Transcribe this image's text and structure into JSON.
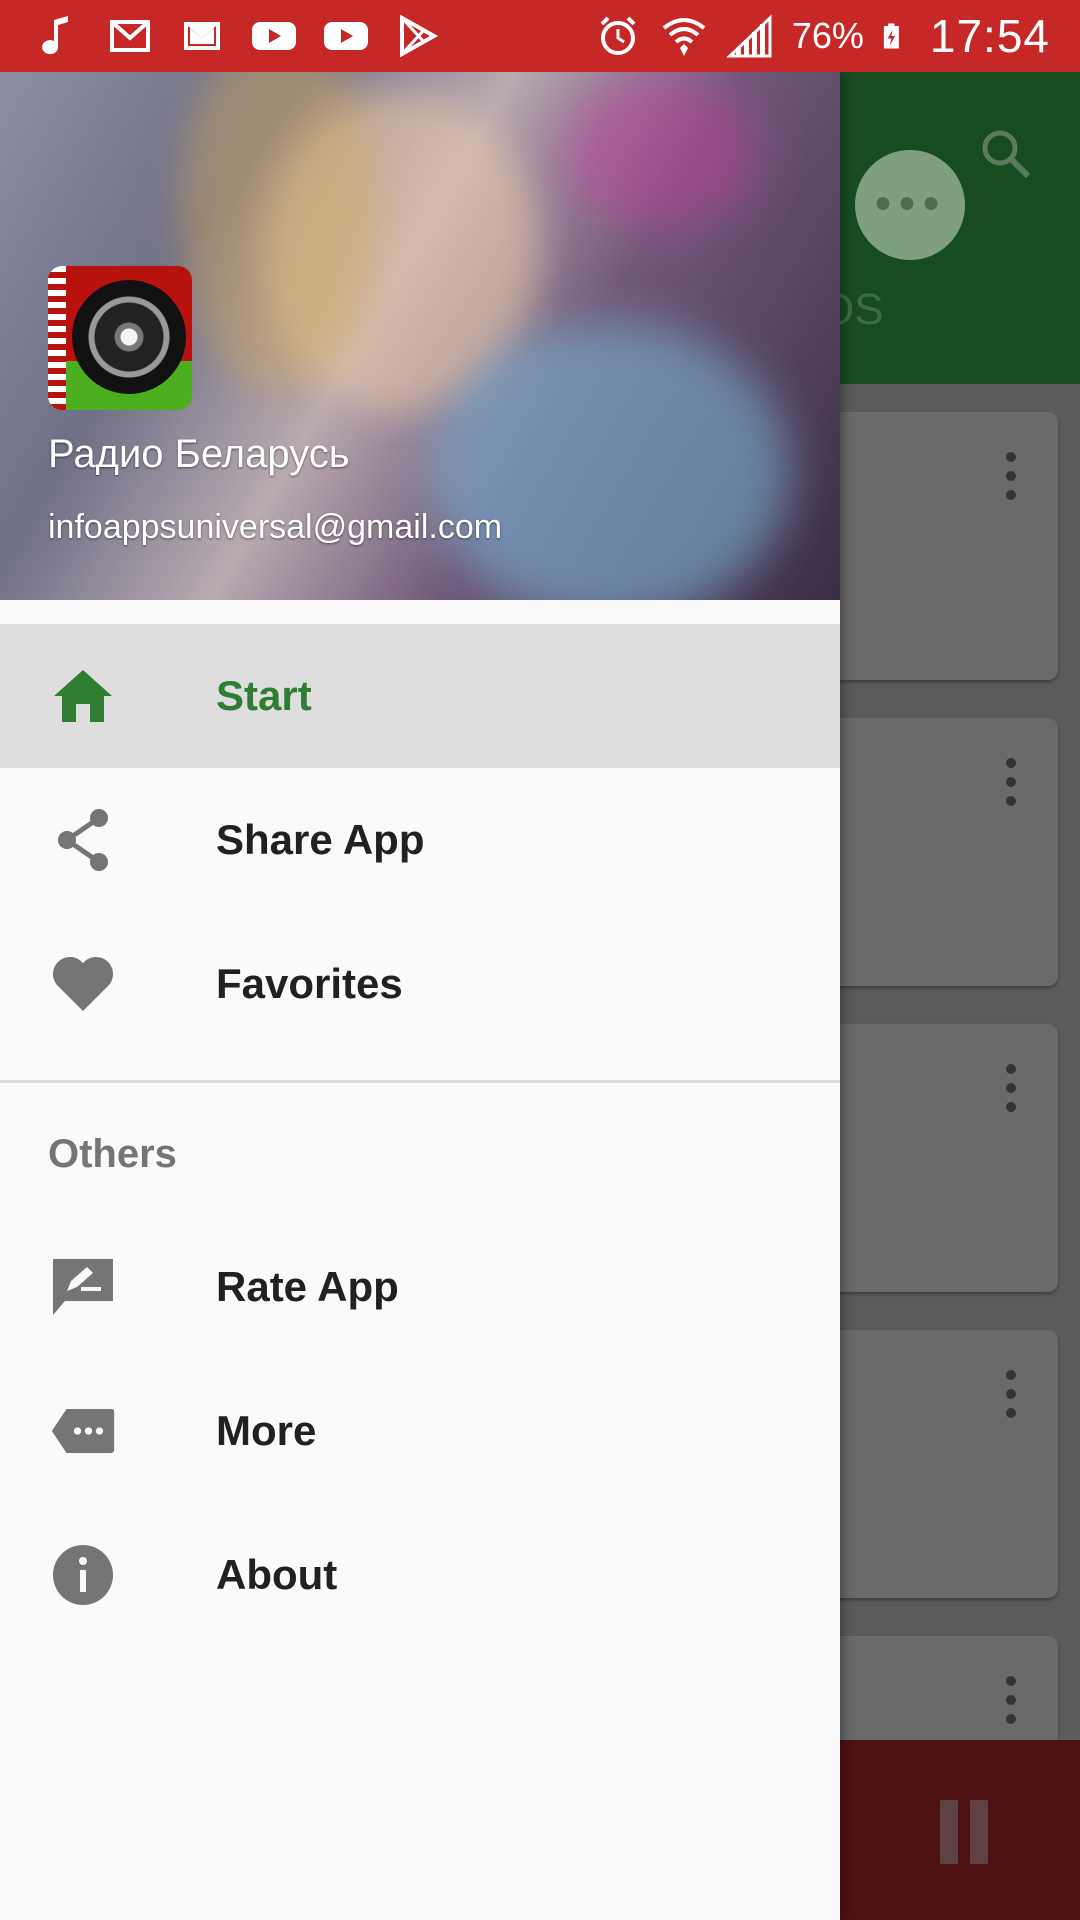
{
  "status_bar": {
    "battery_percent": "76%",
    "time": "17:54",
    "color": "#c62828"
  },
  "background_app": {
    "appbar_color": "#174c1f",
    "tab_fragment": "OS"
  },
  "drawer": {
    "header": {
      "app_name": "Радио Беларусь",
      "email": "infoappsuniversal@gmail.com"
    },
    "items": [
      {
        "label": "Start",
        "icon": "home-icon",
        "active": true
      },
      {
        "label": "Share App",
        "icon": "share-icon"
      },
      {
        "label": "Favorites",
        "icon": "heart-icon"
      }
    ],
    "section_label": "Others",
    "other_items": [
      {
        "label": "Rate App",
        "icon": "rate-review-icon"
      },
      {
        "label": "More",
        "icon": "more-tag-icon"
      },
      {
        "label": "About",
        "icon": "info-icon"
      }
    ],
    "active_color": "#2e7d32"
  }
}
